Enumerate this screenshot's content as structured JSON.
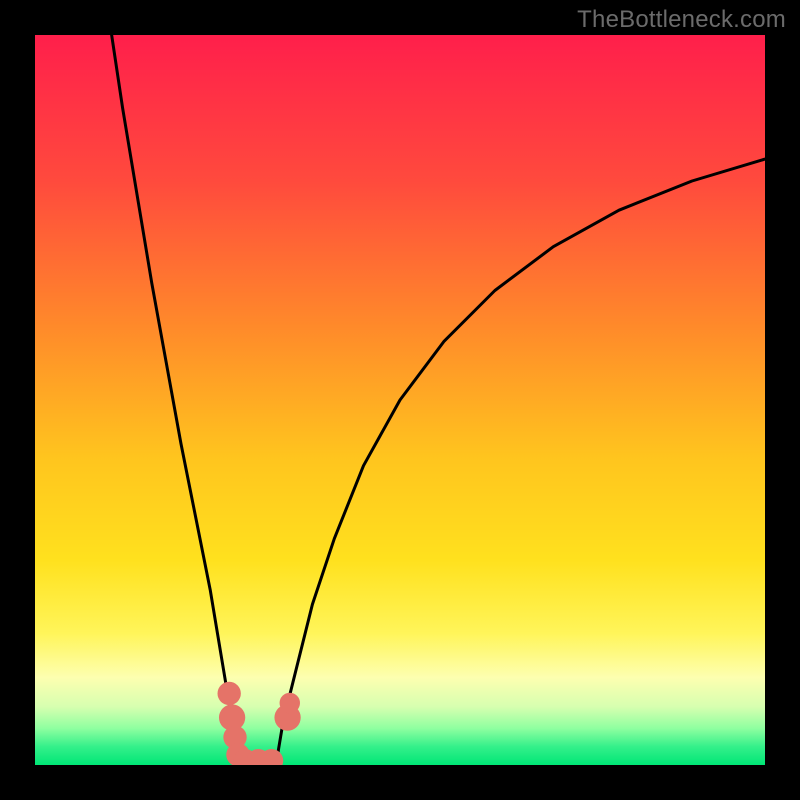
{
  "watermark": "TheBottleneck.com",
  "chart_data": {
    "type": "line",
    "title": "",
    "xlabel": "",
    "ylabel": "",
    "xlim": [
      0,
      100
    ],
    "ylim": [
      0,
      100
    ],
    "background_gradient": {
      "stops": [
        {
          "pos": 0.0,
          "color": "#ff1f4b"
        },
        {
          "pos": 0.2,
          "color": "#ff4a3d"
        },
        {
          "pos": 0.4,
          "color": "#ff8a2a"
        },
        {
          "pos": 0.58,
          "color": "#ffc51e"
        },
        {
          "pos": 0.72,
          "color": "#ffe11e"
        },
        {
          "pos": 0.82,
          "color": "#fff55a"
        },
        {
          "pos": 0.88,
          "color": "#fdffb0"
        },
        {
          "pos": 0.92,
          "color": "#d7ffb0"
        },
        {
          "pos": 0.95,
          "color": "#8effa0"
        },
        {
          "pos": 0.975,
          "color": "#34f08a"
        },
        {
          "pos": 1.0,
          "color": "#00e676"
        }
      ]
    },
    "series": [
      {
        "name": "left-branch",
        "x": [
          10.5,
          12,
          14,
          16,
          18,
          20,
          22,
          24,
          25,
          26,
          27,
          27.8
        ],
        "y": [
          100,
          90,
          78,
          66,
          55,
          44,
          34,
          24,
          18,
          12,
          6,
          0
        ]
      },
      {
        "name": "right-branch",
        "x": [
          33,
          34,
          36,
          38,
          41,
          45,
          50,
          56,
          63,
          71,
          80,
          90,
          100
        ],
        "y": [
          0,
          6,
          14,
          22,
          31,
          41,
          50,
          58,
          65,
          71,
          76,
          80,
          83
        ]
      },
      {
        "name": "valley-floor",
        "x": [
          27.8,
          30,
          33
        ],
        "y": [
          0,
          0,
          0
        ]
      }
    ],
    "markers": [
      {
        "name": "left-cluster-1",
        "x": 26.6,
        "y": 9.8,
        "r": 1.6
      },
      {
        "name": "left-cluster-2",
        "x": 27.0,
        "y": 6.5,
        "r": 1.8
      },
      {
        "name": "left-cluster-3",
        "x": 27.4,
        "y": 3.8,
        "r": 1.6
      },
      {
        "name": "left-cluster-4",
        "x": 27.8,
        "y": 1.4,
        "r": 1.6
      },
      {
        "name": "floor-1",
        "x": 28.8,
        "y": 0.6,
        "r": 1.6
      },
      {
        "name": "floor-2",
        "x": 30.6,
        "y": 0.6,
        "r": 1.6
      },
      {
        "name": "floor-3",
        "x": 32.4,
        "y": 0.6,
        "r": 1.6
      },
      {
        "name": "right-cluster-1",
        "x": 34.6,
        "y": 6.5,
        "r": 1.8
      },
      {
        "name": "right-cluster-2",
        "x": 34.9,
        "y": 8.5,
        "r": 1.4
      }
    ],
    "curve_color": "#000000",
    "marker_color": "#e57368"
  }
}
